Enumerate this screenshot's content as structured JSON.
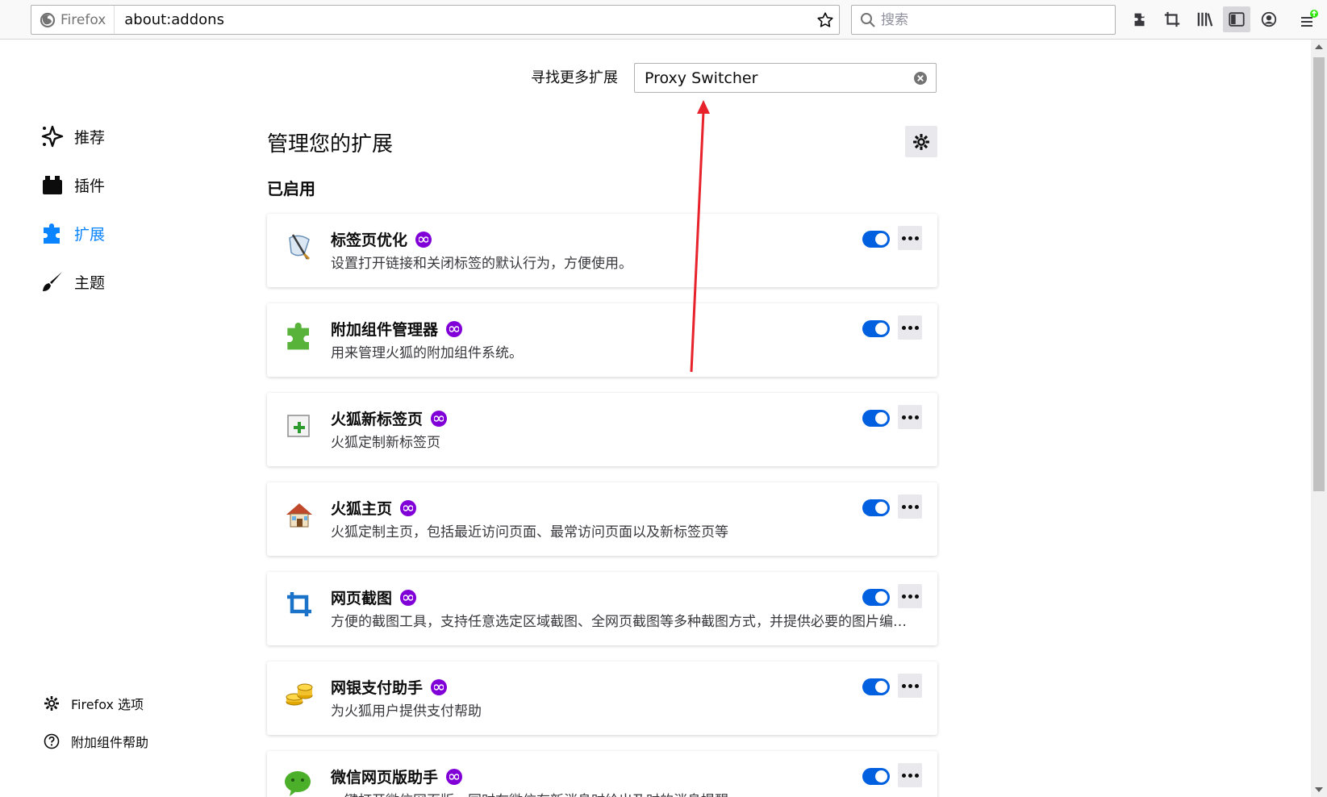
{
  "browser": {
    "brand": "Firefox",
    "url": "about:addons",
    "search_placeholder": "搜索"
  },
  "sidebar": {
    "categories": [
      {
        "label": "推荐",
        "icon": "sparkle-icon"
      },
      {
        "label": "插件",
        "icon": "plugin-block-icon"
      },
      {
        "label": "扩展",
        "icon": "puzzle-icon",
        "selected": true
      },
      {
        "label": "主题",
        "icon": "brush-icon"
      }
    ],
    "footer": [
      {
        "label": "Firefox 选项",
        "icon": "gear-icon"
      },
      {
        "label": "附加组件帮助",
        "icon": "help-icon"
      }
    ]
  },
  "main": {
    "find_label": "寻找更多扩展",
    "find_value": "Proxy Switcher",
    "heading": "管理您的扩展",
    "section_label": "已启用",
    "extensions": [
      {
        "name": "标签页优化",
        "description": "设置打开链接和关闭标签的默认行为，方便使用。",
        "icon": "tab-tweak-icon",
        "enabled": true
      },
      {
        "name": "附加组件管理器",
        "description": "用来管理火狐的附加组件系统。",
        "icon": "green-puzzle-icon",
        "enabled": true
      },
      {
        "name": "火狐新标签页",
        "description": "火狐定制新标签页",
        "icon": "new-tab-icon",
        "enabled": true
      },
      {
        "name": "火狐主页",
        "description": "火狐定制主页，包括最近访问页面、最常访问页面以及新标签页等",
        "icon": "house-icon",
        "enabled": true
      },
      {
        "name": "网页截图",
        "description": "方便的截图工具，支持任意选定区域截图、全网页截图等多种截图方式，并提供必要的图片编辑功能。",
        "icon": "crop-icon",
        "enabled": true
      },
      {
        "name": "网银支付助手",
        "description": "为火狐用户提供支付帮助",
        "icon": "coins-icon",
        "enabled": true
      },
      {
        "name": "微信网页版助手",
        "description": "一键打开微信网页版，同时在微信有新消息时给出及时的消息提醒",
        "icon": "wechat-icon",
        "enabled": true
      }
    ]
  },
  "colors": {
    "accent": "#0a84ff",
    "toggle_on": "#0060df",
    "badge": "#8000d7",
    "annotation_arrow": "#e8222b"
  }
}
